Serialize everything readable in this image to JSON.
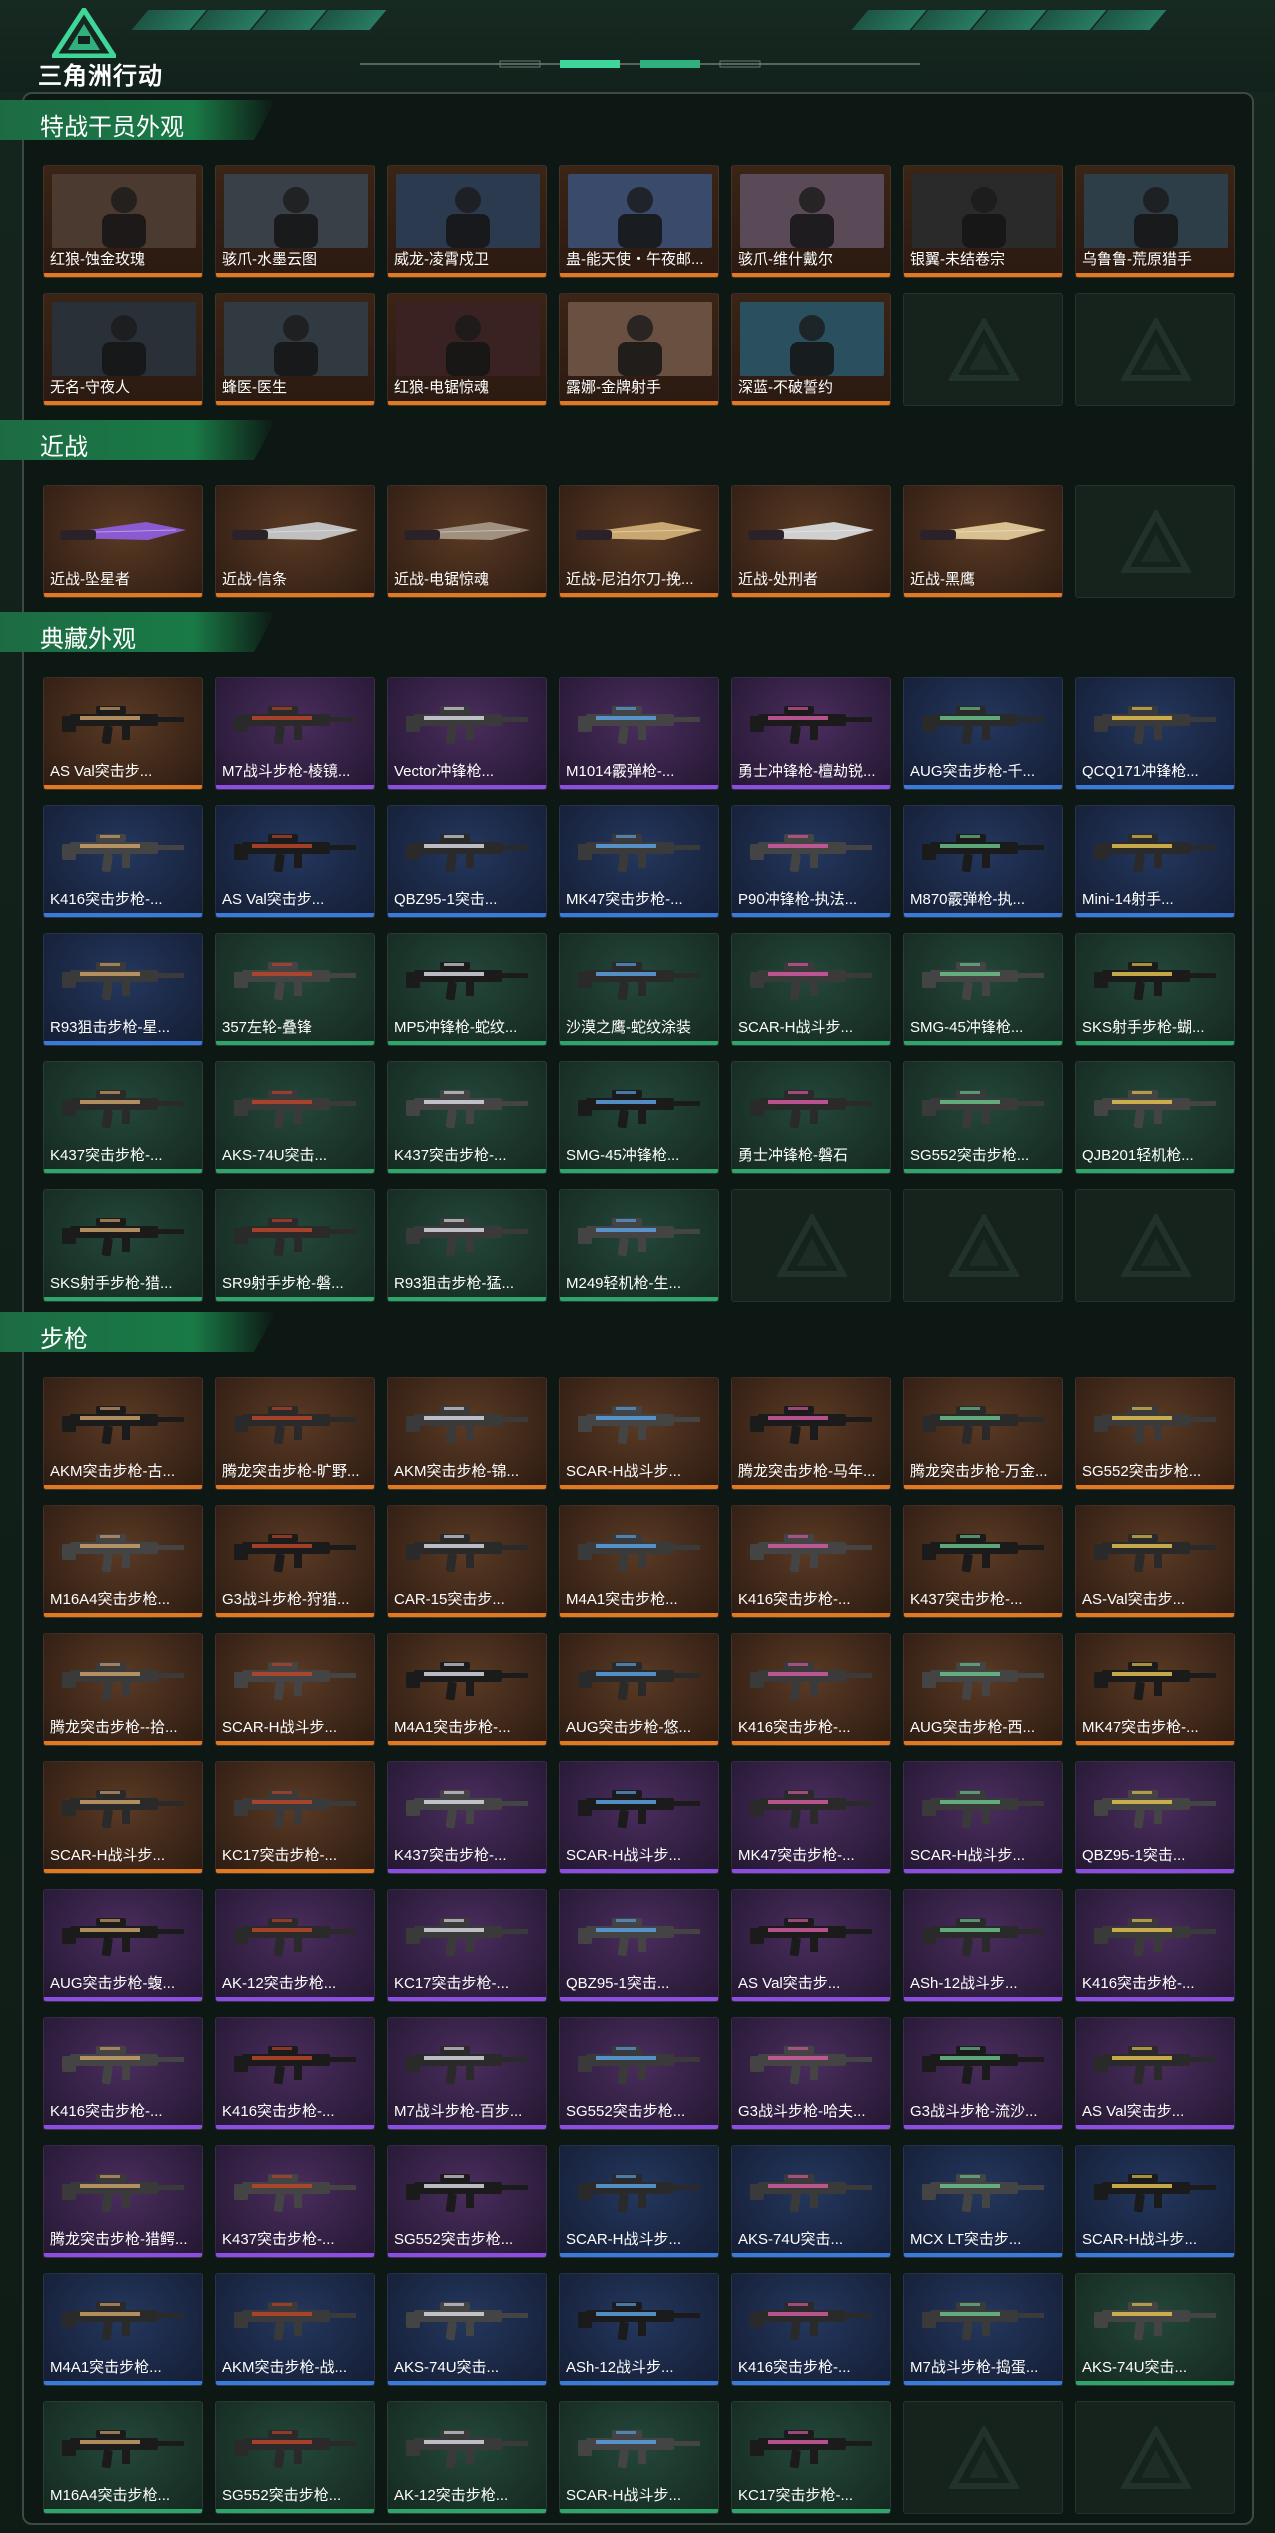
{
  "header": {
    "brand": "三角洲行动",
    "logo_icon": "delta-force-logo-icon"
  },
  "sections": [
    {
      "key": "operators",
      "title": "特战干员外观",
      "style": "op",
      "items": [
        "红狼-蚀金玫瑰",
        "骇爪-水墨云图",
        "威龙-凌霄戍卫",
        "蛊-能天使・午夜邮...",
        "骇爪-维什戴尔",
        "银翼-未结卷宗",
        "乌鲁鲁-荒原猎手",
        "无名-守夜人",
        "蜂医-医生",
        "红狼-电锯惊魂",
        "露娜-金牌射手",
        "深蓝-不破誓约"
      ],
      "empty_slots": 2
    },
    {
      "key": "melee",
      "title": "近战",
      "style": "gold",
      "items": [
        "近战-坠星者",
        "近战-信条",
        "近战-电锯惊魂",
        "近战-尼泊尔刀-挽...",
        "近战-处刑者",
        "近战-黑鹰"
      ],
      "empty_slots": 1
    },
    {
      "key": "collection",
      "title": "典藏外观",
      "items": [
        {
          "n": "AS Val突击步...",
          "r": "gold"
        },
        {
          "n": "M7战斗步枪-棱镜...",
          "r": "purple"
        },
        {
          "n": "Vector冲锋枪...",
          "r": "purple"
        },
        {
          "n": "M1014霰弹枪-...",
          "r": "purple"
        },
        {
          "n": "勇士冲锋枪-檀劫锐...",
          "r": "purple"
        },
        {
          "n": "AUG突击步枪-千...",
          "r": "blue"
        },
        {
          "n": "QCQ171冲锋枪...",
          "r": "blue"
        },
        {
          "n": "K416突击步枪-...",
          "r": "blue"
        },
        {
          "n": "AS Val突击步...",
          "r": "blue"
        },
        {
          "n": "QBZ95-1突击...",
          "r": "blue"
        },
        {
          "n": "MK47突击步枪-...",
          "r": "blue"
        },
        {
          "n": "P90冲锋枪-执法...",
          "r": "blue"
        },
        {
          "n": "M870霰弹枪-执...",
          "r": "blue"
        },
        {
          "n": "Mini-14射手...",
          "r": "blue"
        },
        {
          "n": "R93狙击步枪-星...",
          "r": "blue"
        },
        {
          "n": "357左轮-叠锋",
          "r": "green"
        },
        {
          "n": "MP5冲锋枪-蛇纹...",
          "r": "green"
        },
        {
          "n": "沙漠之鹰-蛇纹涂装",
          "r": "green"
        },
        {
          "n": "SCAR-H战斗步...",
          "r": "green"
        },
        {
          "n": "SMG-45冲锋枪...",
          "r": "green"
        },
        {
          "n": "SKS射手步枪-蝴...",
          "r": "green"
        },
        {
          "n": "K437突击步枪-...",
          "r": "green"
        },
        {
          "n": "AKS-74U突击...",
          "r": "green"
        },
        {
          "n": "K437突击步枪-...",
          "r": "green"
        },
        {
          "n": "SMG-45冲锋枪...",
          "r": "green"
        },
        {
          "n": "勇士冲锋枪-磐石",
          "r": "green"
        },
        {
          "n": "SG552突击步枪...",
          "r": "green"
        },
        {
          "n": "QJB201轻机枪...",
          "r": "green"
        },
        {
          "n": "SKS射手步枪-猎...",
          "r": "green"
        },
        {
          "n": "SR9射手步枪-磐...",
          "r": "green"
        },
        {
          "n": "R93狙击步枪-猛...",
          "r": "green"
        },
        {
          "n": "M249轻机枪-生...",
          "r": "green"
        }
      ],
      "empty_slots": 3
    },
    {
      "key": "rifles",
      "title": "步枪",
      "items": [
        {
          "n": "AKM突击步枪-古...",
          "r": "gold"
        },
        {
          "n": "腾龙突击步枪-旷野...",
          "r": "gold"
        },
        {
          "n": "AKM突击步枪-锦...",
          "r": "gold"
        },
        {
          "n": "SCAR-H战斗步...",
          "r": "gold"
        },
        {
          "n": "腾龙突击步枪-马年...",
          "r": "gold"
        },
        {
          "n": "腾龙突击步枪-万金...",
          "r": "gold"
        },
        {
          "n": "SG552突击步枪...",
          "r": "gold"
        },
        {
          "n": "M16A4突击步枪...",
          "r": "gold"
        },
        {
          "n": "G3战斗步枪-狩猎...",
          "r": "gold"
        },
        {
          "n": "CAR-15突击步...",
          "r": "gold"
        },
        {
          "n": "M4A1突击步枪...",
          "r": "gold"
        },
        {
          "n": "K416突击步枪-...",
          "r": "gold"
        },
        {
          "n": "K437突击步枪-...",
          "r": "gold"
        },
        {
          "n": "AS-Val突击步...",
          "r": "gold"
        },
        {
          "n": "腾龙突击步枪--拾...",
          "r": "gold"
        },
        {
          "n": "SCAR-H战斗步...",
          "r": "gold"
        },
        {
          "n": "M4A1突击步枪-...",
          "r": "gold"
        },
        {
          "n": "AUG突击步枪-悠...",
          "r": "gold"
        },
        {
          "n": "K416突击步枪-...",
          "r": "gold"
        },
        {
          "n": "AUG突击步枪-西...",
          "r": "gold"
        },
        {
          "n": "MK47突击步枪-...",
          "r": "gold"
        },
        {
          "n": "SCAR-H战斗步...",
          "r": "gold"
        },
        {
          "n": "KC17突击步枪-...",
          "r": "gold"
        },
        {
          "n": "K437突击步枪-...",
          "r": "purple"
        },
        {
          "n": "SCAR-H战斗步...",
          "r": "purple"
        },
        {
          "n": "MK47突击步枪-...",
          "r": "purple"
        },
        {
          "n": "SCAR-H战斗步...",
          "r": "purple"
        },
        {
          "n": "QBZ95-1突击...",
          "r": "purple"
        },
        {
          "n": "AUG突击步枪-蝮...",
          "r": "purple"
        },
        {
          "n": "AK-12突击步枪...",
          "r": "purple"
        },
        {
          "n": "KC17突击步枪-...",
          "r": "purple"
        },
        {
          "n": "QBZ95-1突击...",
          "r": "purple"
        },
        {
          "n": "AS Val突击步...",
          "r": "purple"
        },
        {
          "n": "ASh-12战斗步...",
          "r": "purple"
        },
        {
          "n": "K416突击步枪-...",
          "r": "purple"
        },
        {
          "n": "K416突击步枪-...",
          "r": "purple"
        },
        {
          "n": "K416突击步枪-...",
          "r": "purple"
        },
        {
          "n": "M7战斗步枪-百步...",
          "r": "purple"
        },
        {
          "n": "SG552突击步枪...",
          "r": "purple"
        },
        {
          "n": "G3战斗步枪-哈夫...",
          "r": "purple"
        },
        {
          "n": "G3战斗步枪-流沙...",
          "r": "purple"
        },
        {
          "n": "AS Val突击步...",
          "r": "purple"
        },
        {
          "n": "腾龙突击步枪-猎鳄...",
          "r": "purple"
        },
        {
          "n": "K437突击步枪-...",
          "r": "purple"
        },
        {
          "n": "SG552突击步枪...",
          "r": "purple"
        },
        {
          "n": "SCAR-H战斗步...",
          "r": "blue"
        },
        {
          "n": "AKS-74U突击...",
          "r": "blue"
        },
        {
          "n": "MCX LT突击步...",
          "r": "blue"
        },
        {
          "n": "SCAR-H战斗步...",
          "r": "blue"
        },
        {
          "n": "M4A1突击步枪...",
          "r": "blue"
        },
        {
          "n": "AKM突击步枪-战...",
          "r": "blue"
        },
        {
          "n": "AKS-74U突击...",
          "r": "blue"
        },
        {
          "n": "ASh-12战斗步...",
          "r": "blue"
        },
        {
          "n": "K416突击步枪-...",
          "r": "blue"
        },
        {
          "n": "M7战斗步枪-捣蛋...",
          "r": "blue"
        },
        {
          "n": "AKS-74U突击...",
          "r": "green"
        },
        {
          "n": "M16A4突击步枪...",
          "r": "green"
        },
        {
          "n": "SG552突击步枪...",
          "r": "green"
        },
        {
          "n": "AK-12突击步枪...",
          "r": "green"
        },
        {
          "n": "SCAR-H战斗步...",
          "r": "green"
        },
        {
          "n": "KC17突击步枪-...",
          "r": "green"
        }
      ],
      "empty_slots": 2
    }
  ]
}
